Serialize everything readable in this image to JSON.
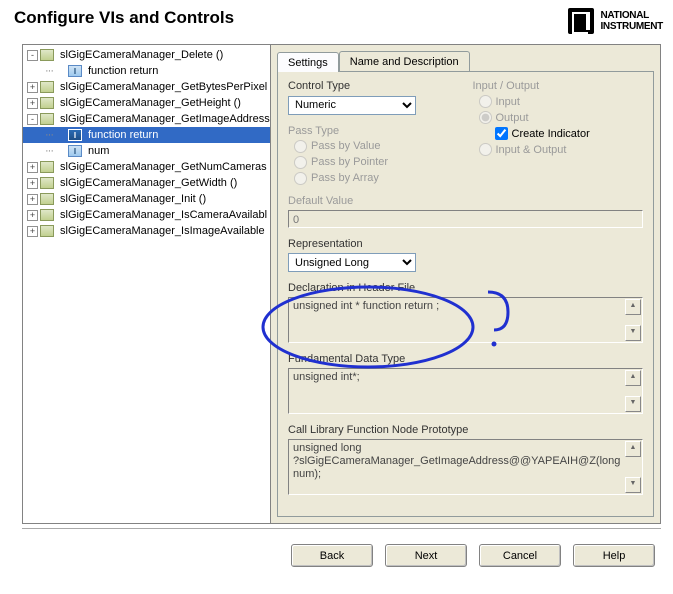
{
  "title": "Configure VIs and Controls",
  "logo": {
    "line1": "NATIONAL",
    "line2": "INSTRUMENT"
  },
  "tree": [
    {
      "depth": 0,
      "exp": "-",
      "icon": "fn",
      "label": "slGigECameraManager_Delete ()"
    },
    {
      "depth": 1,
      "exp": "",
      "icon": "io",
      "label": "function return"
    },
    {
      "depth": 0,
      "exp": "+",
      "icon": "fn",
      "label": "slGigECameraManager_GetBytesPerPixel"
    },
    {
      "depth": 0,
      "exp": "+",
      "icon": "fn",
      "label": "slGigECameraManager_GetHeight ()"
    },
    {
      "depth": 0,
      "exp": "-",
      "icon": "fn",
      "label": "slGigECameraManager_GetImageAddress"
    },
    {
      "depth": 1,
      "exp": "",
      "icon": "io",
      "label": "function return",
      "selected": true
    },
    {
      "depth": 1,
      "exp": "",
      "icon": "io",
      "label": "num"
    },
    {
      "depth": 0,
      "exp": "+",
      "icon": "fn",
      "label": "slGigECameraManager_GetNumCameras"
    },
    {
      "depth": 0,
      "exp": "+",
      "icon": "fn",
      "label": "slGigECameraManager_GetWidth ()"
    },
    {
      "depth": 0,
      "exp": "+",
      "icon": "fn",
      "label": "slGigECameraManager_Init ()"
    },
    {
      "depth": 0,
      "exp": "+",
      "icon": "fn",
      "label": "slGigECameraManager_IsCameraAvailabl"
    },
    {
      "depth": 0,
      "exp": "+",
      "icon": "fn",
      "label": "slGigECameraManager_IsImageAvailable"
    }
  ],
  "tabs": {
    "settings": "Settings",
    "nameDesc": "Name and Description"
  },
  "controlType": {
    "label": "Control Type",
    "value": "Numeric"
  },
  "passType": {
    "label": "Pass Type",
    "options": [
      "Pass by Value",
      "Pass by Pointer",
      "Pass by Array"
    ]
  },
  "inputOutput": {
    "label": "Input / Output",
    "options": [
      "Input",
      "Output",
      "Input & Output"
    ],
    "checkbox": "Create Indicator"
  },
  "defaultValue": {
    "label": "Default Value",
    "value": "0"
  },
  "representation": {
    "label": "Representation",
    "value": "Unsigned Long"
  },
  "declaration": {
    "label": "Declaration in Header File",
    "value": "unsigned int * function return ;"
  },
  "fundamental": {
    "label": "Fundamental Data Type",
    "value": "unsigned int*;"
  },
  "prototype": {
    "label": "Call Library Function Node Prototype",
    "value": "unsigned long\n?slGigECameraManager_GetImageAddress@@YAPEAIH@Z(long num);"
  },
  "buttons": {
    "back": "Back",
    "next": "Next",
    "cancel": "Cancel",
    "help": "Help"
  }
}
